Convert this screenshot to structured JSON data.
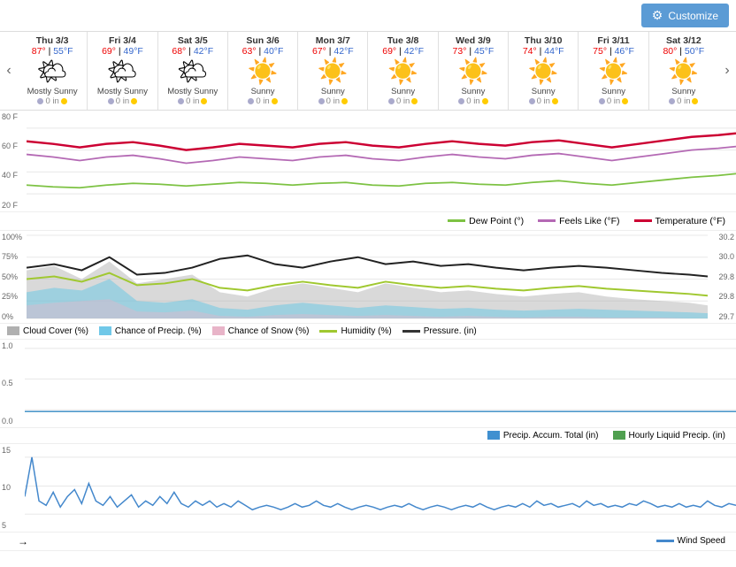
{
  "topbar": {
    "customize_label": "Customize"
  },
  "days": [
    {
      "date": "Thu 3/3",
      "high": "87°",
      "low": "55°F",
      "icon": "🌤",
      "condition": "Mostly Sunny",
      "precip": "0 in"
    },
    {
      "date": "Fri 3/4",
      "high": "69°",
      "low": "49°F",
      "icon": "🌤",
      "condition": "Mostly Sunny",
      "precip": "0 in"
    },
    {
      "date": "Sat 3/5",
      "high": "68°",
      "low": "42°F",
      "icon": "🌤",
      "condition": "Mostly Sunny",
      "precip": "0 in"
    },
    {
      "date": "Sun 3/6",
      "high": "63°",
      "low": "40°F",
      "icon": "☀️",
      "condition": "Sunny",
      "precip": "0 in"
    },
    {
      "date": "Mon 3/7",
      "high": "67°",
      "low": "42°F",
      "icon": "☀️",
      "condition": "Sunny",
      "precip": "0 in"
    },
    {
      "date": "Tue 3/8",
      "high": "69°",
      "low": "42°F",
      "icon": "☀️",
      "condition": "Sunny",
      "precip": "0 in"
    },
    {
      "date": "Wed 3/9",
      "high": "73°",
      "low": "45°F",
      "icon": "☀️",
      "condition": "Sunny",
      "precip": "0 in"
    },
    {
      "date": "Thu 3/10",
      "high": "74°",
      "low": "44°F",
      "icon": "☀️",
      "condition": "Sunny",
      "precip": "0 in"
    },
    {
      "date": "Fri 3/11",
      "high": "75°",
      "low": "46°F",
      "icon": "☀️",
      "condition": "Sunny",
      "precip": "0 in"
    },
    {
      "date": "Sat 3/12",
      "high": "80°",
      "low": "50°F",
      "icon": "☀️",
      "condition": "Sunny",
      "precip": "0 in"
    }
  ],
  "temp_chart": {
    "y_labels": [
      "80 F",
      "60 F",
      "40 F",
      "20 F"
    ]
  },
  "legend1": {
    "dew_point": "Dew Point (°)",
    "feels_like": "Feels Like (°F)",
    "temperature": "Temperature (°F)"
  },
  "pct_chart": {
    "y_labels_left": [
      "100%",
      "75%",
      "50%",
      "25%",
      "0%"
    ],
    "y_labels_right": [
      "30.2",
      "30.0",
      "29.8",
      "29.8",
      "29.7"
    ]
  },
  "legend2": {
    "cloud_cover": "Cloud Cover (%)",
    "chance_precip": "Chance of Precip. (%)",
    "chance_snow": "Chance of Snow (%)",
    "humidity": "Humidity (%)",
    "pressure": "Pressure. (in)"
  },
  "precip_chart": {
    "y_labels": [
      "1.0",
      "0.5",
      "0.0"
    ]
  },
  "legend3": {
    "accum_total": "Precip. Accum. Total (in)",
    "hourly_liquid": "Hourly Liquid Precip. (in)"
  },
  "wind_chart": {
    "y_labels": [
      "15",
      "10",
      "5"
    ],
    "wind_speed_label": "Wind Speed"
  },
  "nav": {
    "prev": "‹",
    "next": "›"
  }
}
